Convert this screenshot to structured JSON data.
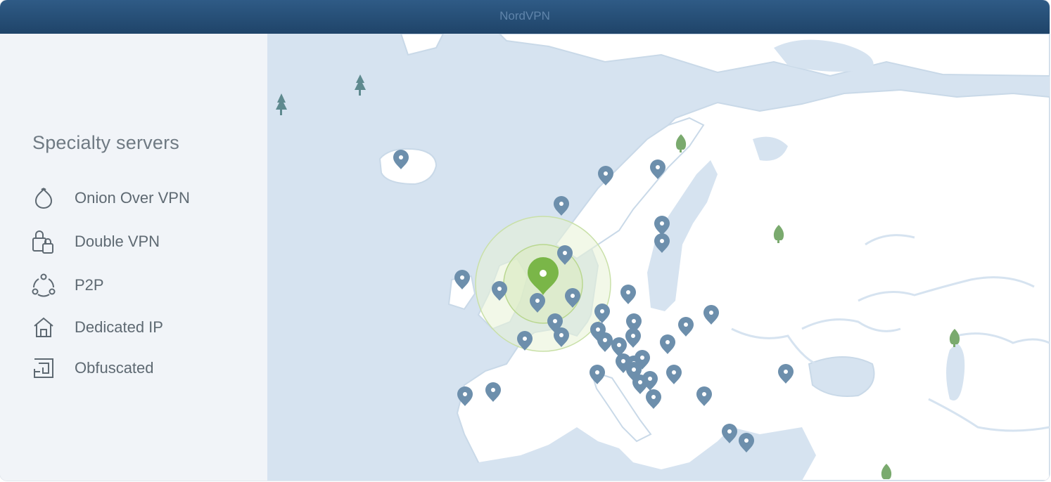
{
  "window": {
    "title": "NordVPN"
  },
  "sidebar": {
    "heading": "Specialty servers",
    "items": [
      {
        "label": "Onion Over VPN",
        "icon": "onion-icon"
      },
      {
        "label": "Double VPN",
        "icon": "double-lock-icon"
      },
      {
        "label": "P2P",
        "icon": "p2p-icon"
      },
      {
        "label": "Dedicated IP",
        "icon": "home-icon"
      },
      {
        "label": "Obfuscated",
        "icon": "obfuscated-icon"
      }
    ]
  },
  "map": {
    "colors": {
      "sea": "#d6e3f0",
      "land": "#ffffff",
      "pin": "#6d8fac",
      "active_pin": "#7ab648",
      "tree": "#7aaa6e"
    },
    "active_location": "connected-server-pin"
  }
}
